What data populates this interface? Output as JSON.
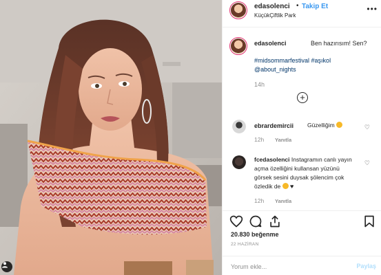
{
  "header": {
    "username": "edasolenci",
    "separator": "•",
    "follow_label": "Takip Et",
    "location": "KüçükÇiftlik Park",
    "more_icon": "more-horizontal-icon"
  },
  "caption": {
    "username": "edasolenci",
    "text": "Ben hazırısım! Sen?",
    "tags": [
      "#midsommarfestival",
      "#aşıkol",
      "@about_nights"
    ],
    "time": "14h"
  },
  "load_more_icon": "plus-circle-icon",
  "comments": [
    {
      "username": "ebrardemircii",
      "text": "Güzelliğim",
      "time": "12h",
      "reply_label": "Yanıtla"
    },
    {
      "username": "fcedasolenci",
      "text": "Instagramın canlı yayın açma özelliğini kullansan yüzünü görsek sesini duysak şölencim çok özledik de",
      "time": "12h",
      "reply_label": "Yanıtla"
    }
  ],
  "actions": {
    "like_icon": "heart-icon",
    "comment_icon": "comment-icon",
    "share_icon": "share-icon",
    "save_icon": "bookmark-icon"
  },
  "likes": "20.830 beğenme",
  "date": "22 HAZİRAN",
  "comment_box": {
    "placeholder": "Yorum ekle...",
    "post_label": "Paylaş"
  },
  "colors": {
    "link_blue": "#3897f0",
    "hashtag_blue": "#003569",
    "muted": "#8e8e8e",
    "story_ring": "#e1306c"
  }
}
